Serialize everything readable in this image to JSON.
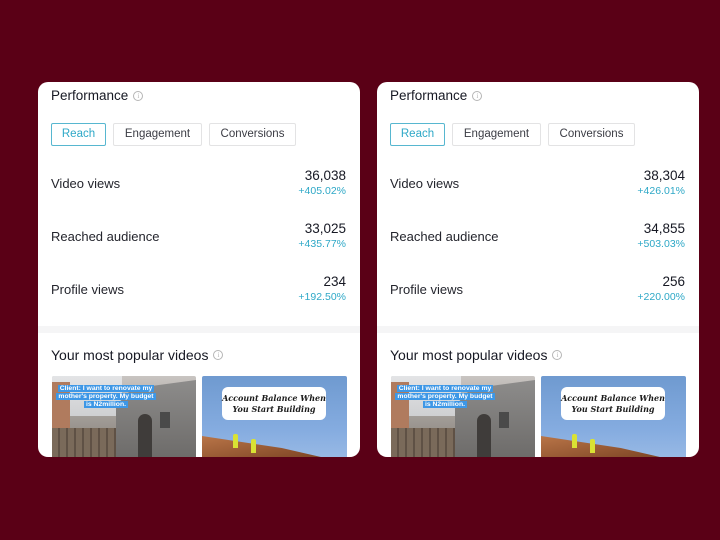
{
  "background_color": "#5a0016",
  "accent_color": "#2ea8c7",
  "panels": [
    {
      "performance": {
        "title": "Performance",
        "info_icon": "info-circle-icon",
        "tabs": [
          {
            "label": "Reach",
            "active": true
          },
          {
            "label": "Engagement",
            "active": false
          },
          {
            "label": "Conversions",
            "active": false
          }
        ],
        "metrics": [
          {
            "label": "Video views",
            "value": "36,038",
            "change": "+405.02%"
          },
          {
            "label": "Reached audience",
            "value": "33,025",
            "change": "+435.77%"
          },
          {
            "label": "Profile views",
            "value": "234",
            "change": "+192.50%"
          }
        ]
      },
      "popular": {
        "title": "Your most popular videos",
        "info_icon": "info-circle-icon",
        "videos": [
          {
            "caption": "Client: I want to renovate my mother's property. My budget is N2million."
          },
          {
            "caption": "Account Balance When You Start Building"
          }
        ]
      }
    },
    {
      "performance": {
        "title": "Performance",
        "info_icon": "info-circle-icon",
        "tabs": [
          {
            "label": "Reach",
            "active": true
          },
          {
            "label": "Engagement",
            "active": false
          },
          {
            "label": "Conversions",
            "active": false
          }
        ],
        "metrics": [
          {
            "label": "Video views",
            "value": "38,304",
            "change": "+426.01%"
          },
          {
            "label": "Reached audience",
            "value": "34,855",
            "change": "+503.03%"
          },
          {
            "label": "Profile views",
            "value": "256",
            "change": "+220.00%"
          }
        ]
      },
      "popular": {
        "title": "Your most popular videos",
        "info_icon": "info-circle-icon",
        "videos": [
          {
            "caption": "Client: I want to renovate my mother's property. My budget is N2million."
          },
          {
            "caption": "Account Balance When You Start Building"
          }
        ]
      }
    }
  ]
}
